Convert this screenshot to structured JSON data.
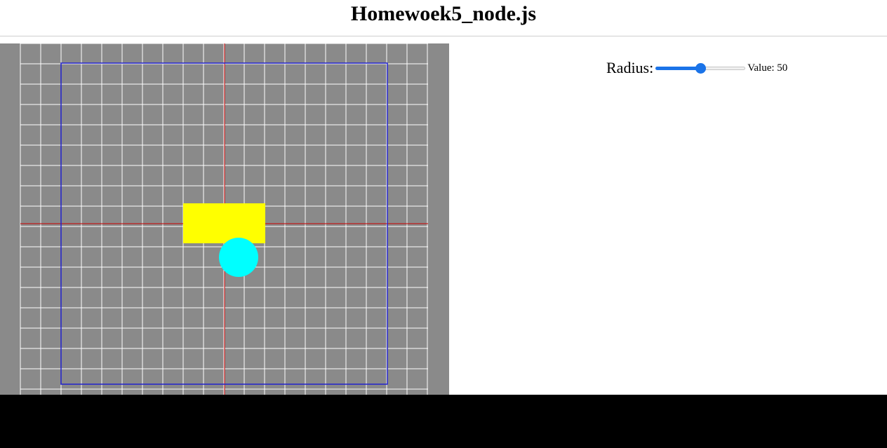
{
  "page": {
    "title": "Homewoek5_node.js"
  },
  "controls": {
    "radius_label": "Radius:",
    "radius_value": 50,
    "radius_min": 0,
    "radius_max": 100,
    "value_text": "Value: 50"
  },
  "scene": {
    "background_color": "#8a8a8a",
    "grid_color": "#ffffff",
    "axis_color": "#cc0000",
    "bounds_color": "#2222cc",
    "rectangle_color": "#ffff00",
    "circle_color": "#00ffff"
  },
  "colors": {
    "slider_accent": "#1a73e8"
  }
}
